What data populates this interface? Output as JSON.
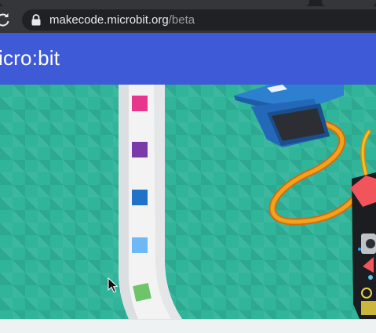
{
  "browser": {
    "url_host": "makecode.microbit.org",
    "url_path": "/beta"
  },
  "header": {
    "brand": "icro:bit"
  },
  "illustration": {
    "palette": [
      "#e8368f",
      "#7a3aa8",
      "#1f72c8",
      "#6db8f5",
      "#6fc46a"
    ],
    "accent_teal": "#30b49a",
    "header_blue": "#3f5ad6"
  }
}
